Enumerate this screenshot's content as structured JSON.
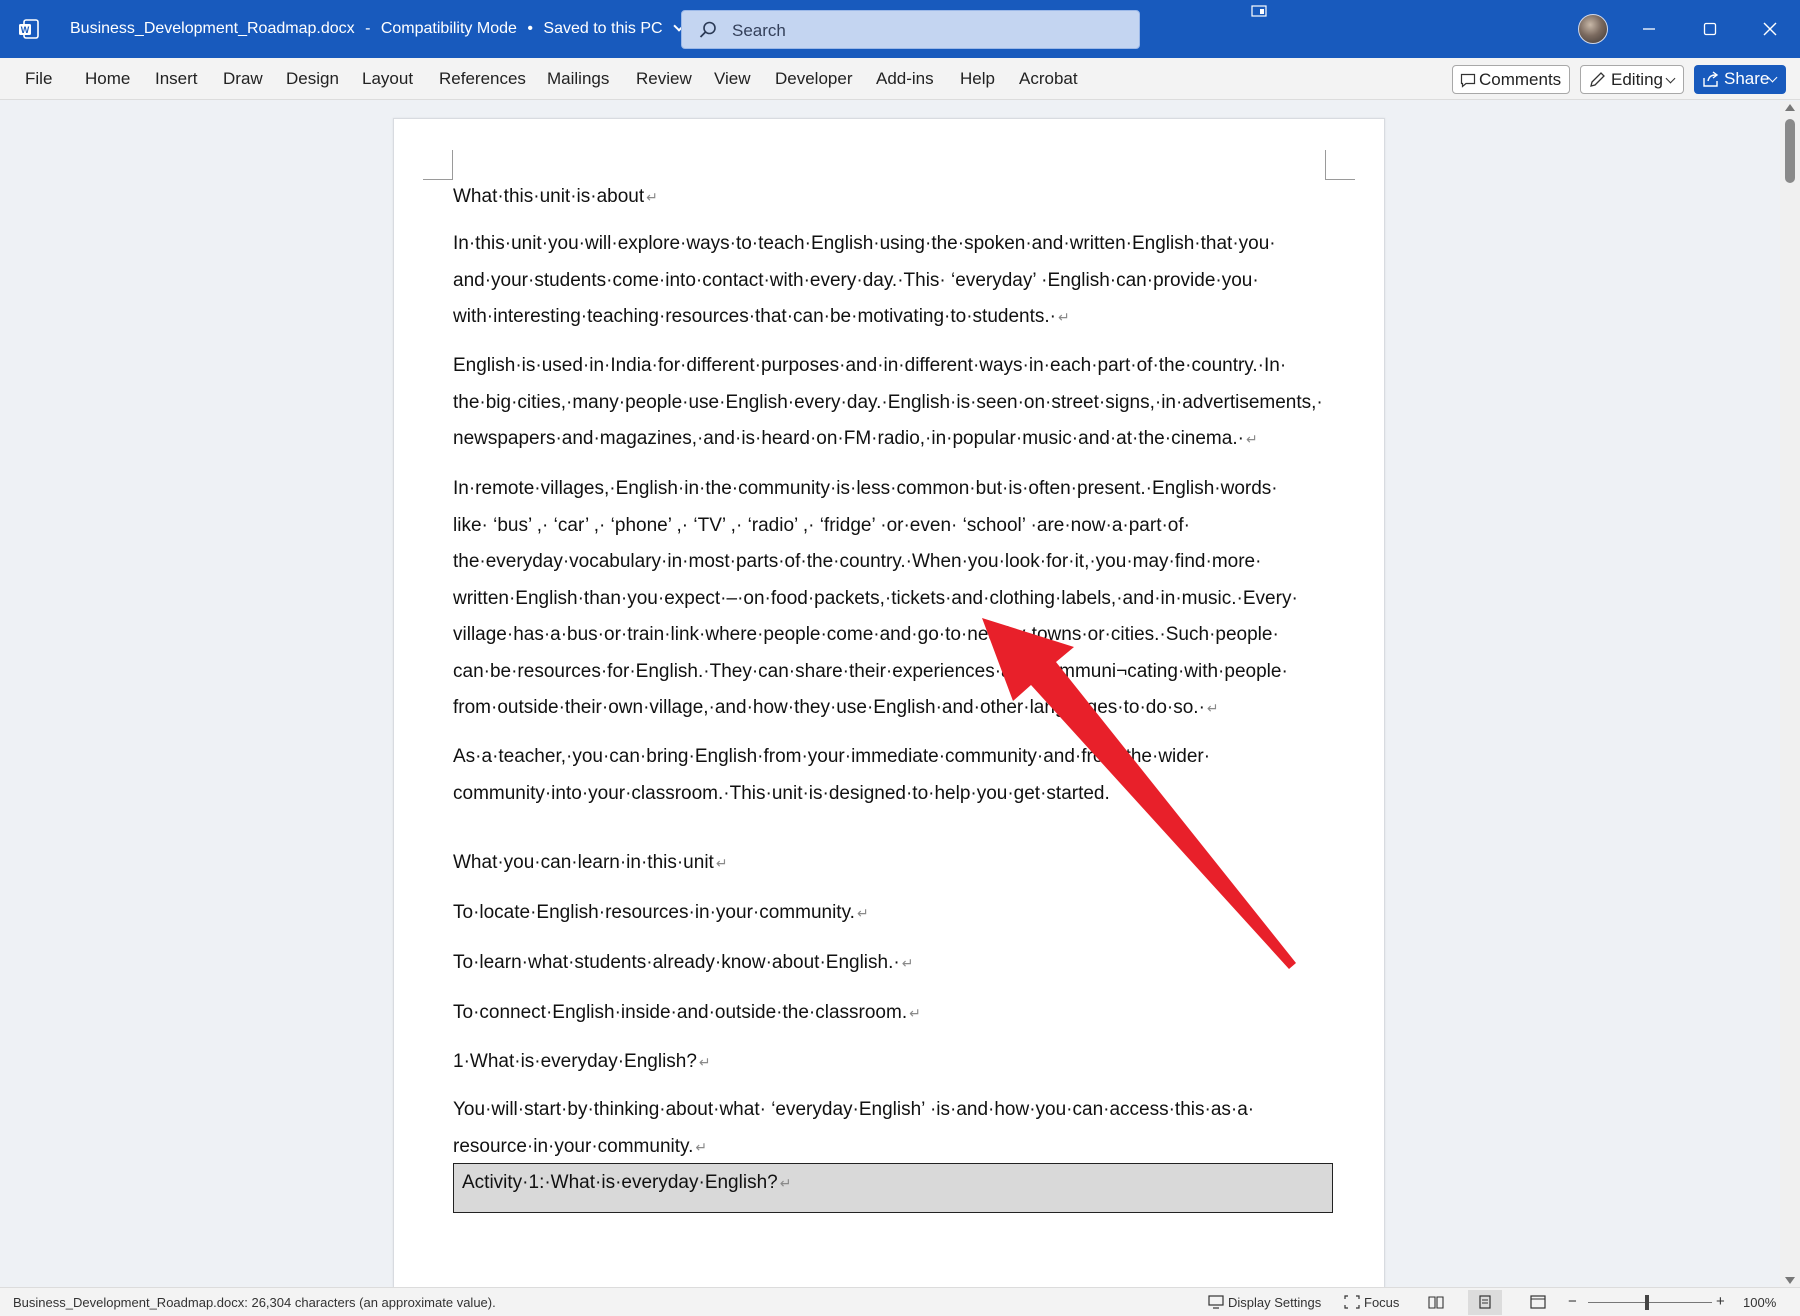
{
  "titlebar": {
    "filename": "Business_Development_Roadmap.docx",
    "separator": "-",
    "mode": "Compatibility Mode",
    "bullet": "•",
    "save_status": "Saved to this PC",
    "search_placeholder": "Search",
    "accent_color": "#185abd"
  },
  "menu": {
    "items": [
      "File",
      "Home",
      "Insert",
      "Draw",
      "Design",
      "Layout",
      "References",
      "Mailings",
      "Review",
      "View",
      "Developer",
      "Add-ins",
      "Help",
      "Acrobat"
    ],
    "comments_label": "Comments",
    "editing_label": "Editing",
    "share_label": "Share"
  },
  "document": {
    "heading1": "What·this·unit·is·about",
    "p1": [
      "In·this·unit·you·will·explore·ways·to·teach·English·using·the·spoken·and·written·English·that·you·",
      "and·your·students·come·into·contact·with·every·day.·This· ‘everyday’ ·English·can·provide·you·",
      "with·interesting·teaching·resources·that·can·be·motivating·to·students.·"
    ],
    "p2": [
      "English·is·used·in·India·for·different·purposes·and·in·different·ways·in·each·part·of·the·country.·In·",
      "the·big·cities,·many·people·use·English·every·day.·English·is·seen·on·street·signs,·in·advertisements,·",
      "newspapers·and·magazines,·and·is·heard·on·FM·radio,·in·popular·music·and·at·the·cinema.·"
    ],
    "p3": [
      "In·remote·villages,·English·in·the·community·is·less·common·but·is·often·present.·English·words·",
      "like· ‘bus’ ,· ‘car’ ,· ‘phone’ ,· ‘TV’ ,· ‘radio’ ,· ‘fridge’ ·or·even· ‘school’ ·are·now·a·part·of·",
      "the·everyday·vocabulary·in·most·parts·of·the·country.·When·you·look·for·it,·you·may·find·more·",
      "written·English·than·you·expect·–·on·food·packets,·tickets·and·clothing·labels,·and·in·music.·Every·",
      "village·has·a·bus·or·train·link·where·people·come·and·go·to·nearby·towns·or·cities.·Such·people·",
      "can·be·resources·for·English.·They·can·share·their·experiences·and·communi¬cating·with·people·",
      "from·outside·their·own·village,·and·how·they·use·English·and·other·languages·to·do·so.·"
    ],
    "p4": [
      "As·a·teacher,·you·can·bring·English·from·your·immediate·community·and·from·the·wider·",
      "community·into·your·classroom.·This·unit·is·designed·to·help·you·get·started."
    ],
    "heading2": "What·you·can·learn·in·this·unit",
    "objective1": "To·locate·English·resources·in·your·community.",
    "objective2": "To·learn·what·students·already·know·about·English.·",
    "objective3": "To·connect·English·inside·and·outside·the·classroom.",
    "heading3": "1·What·is·everyday·English?",
    "p5": [
      "You·will·start·by·thinking·about·what· ‘everyday·English’ ·is·and·how·you·can·access·this·as·a·",
      "resource·in·your·community."
    ],
    "activity": "Activity·1:·What·is·everyday·English?",
    "para_mark": "↵"
  },
  "statusbar": {
    "doc_info": "Business_Development_Roadmap.docx: 26,304 characters (an approximate value).",
    "display_settings": "Display Settings",
    "focus": "Focus",
    "zoom_minus": "−",
    "zoom_plus": "+",
    "zoom_level": "100%"
  },
  "annotation": {
    "arrow_color": "#e8202a"
  }
}
